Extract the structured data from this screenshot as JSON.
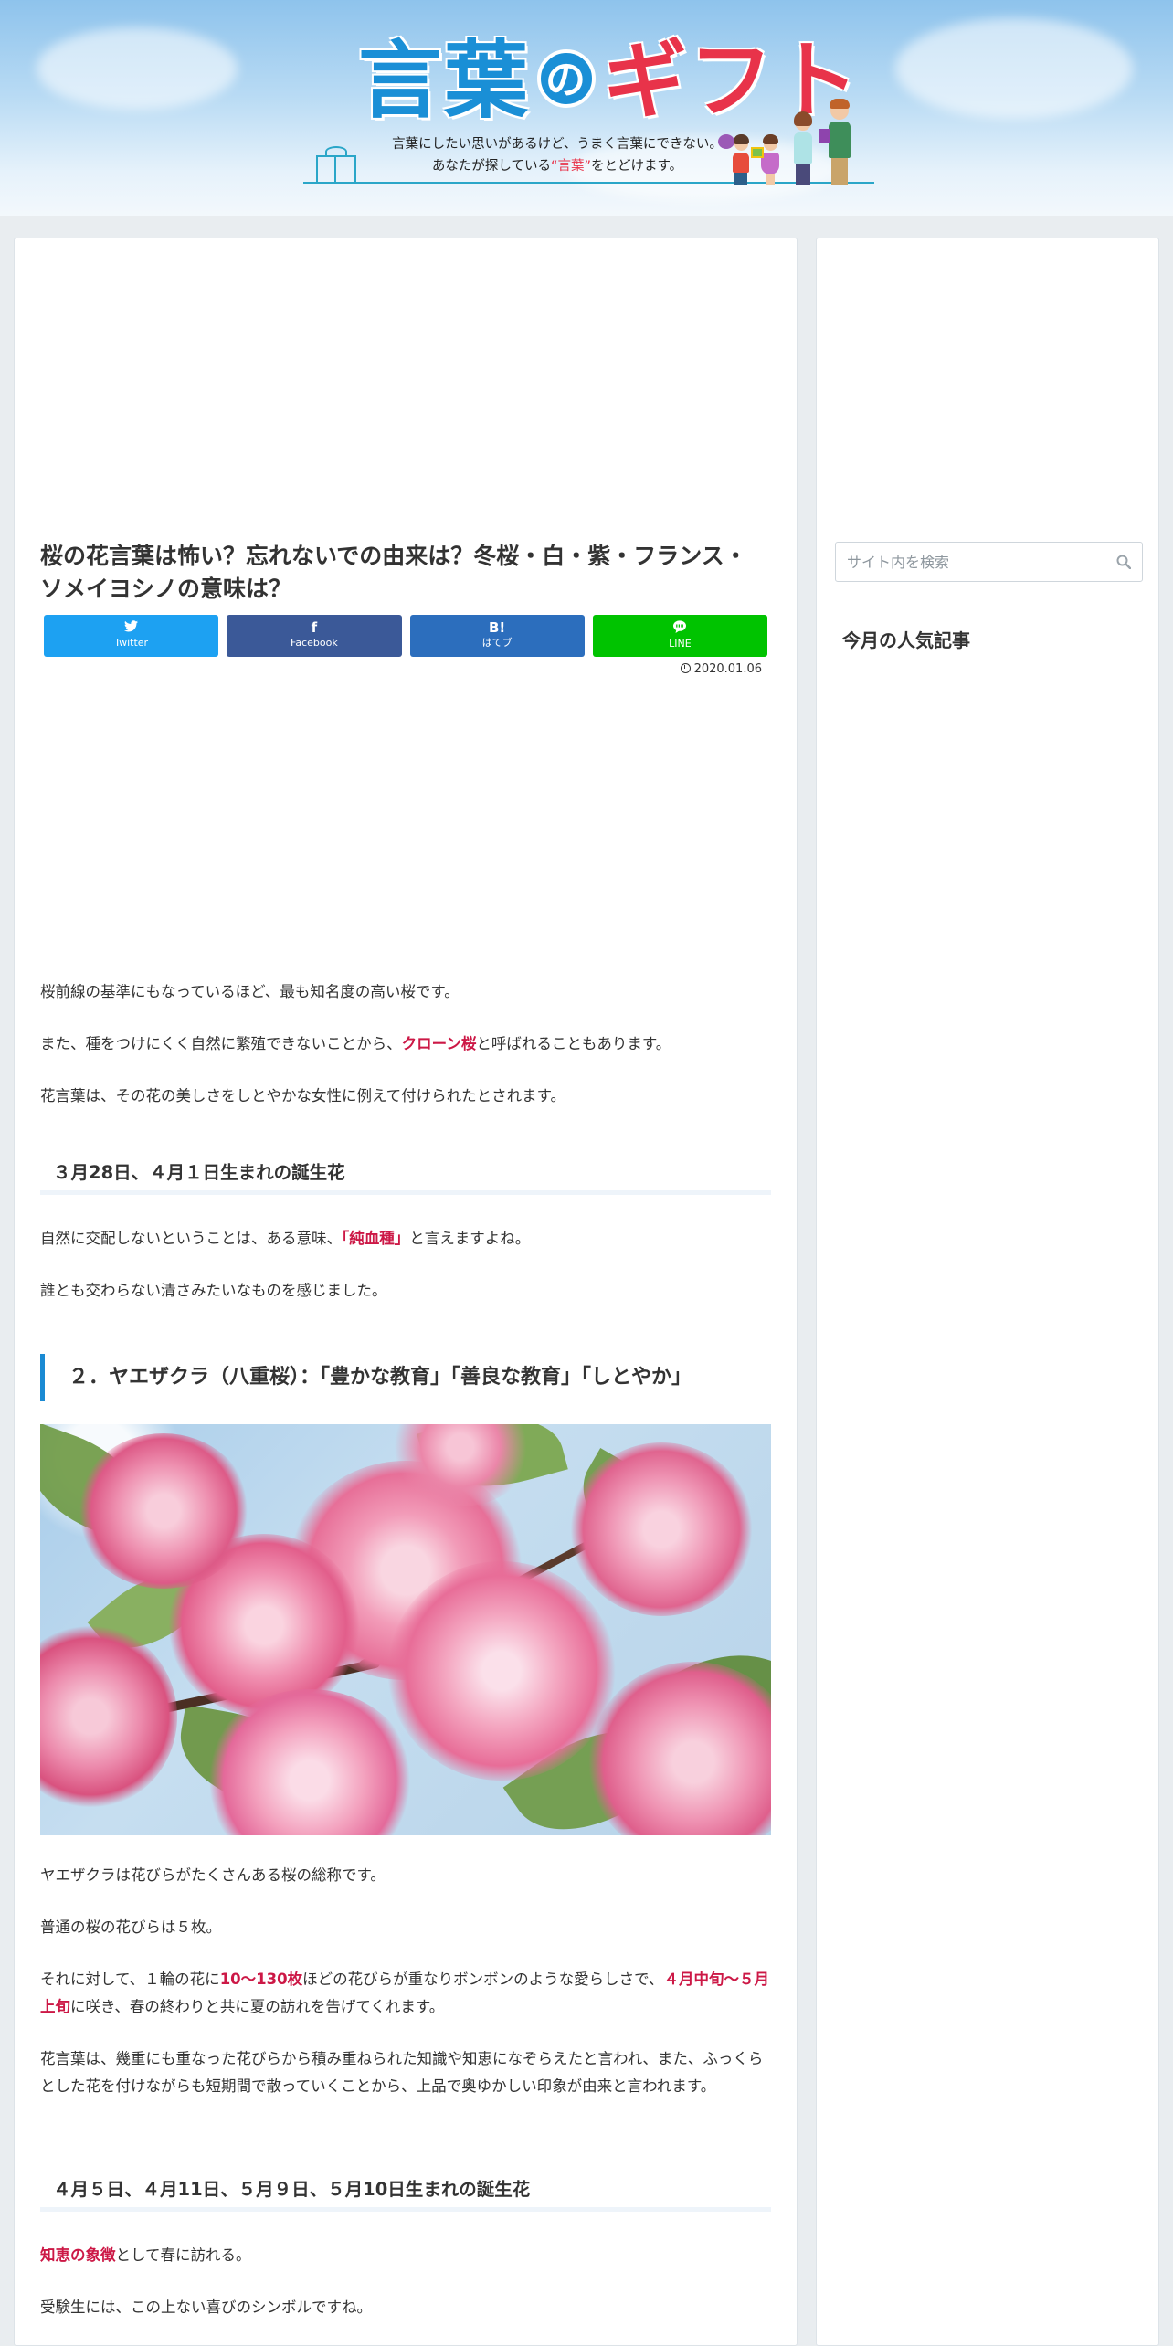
{
  "header": {
    "logo_part1": "言葉",
    "logo_no": "の",
    "logo_part2": "ギフト",
    "tagline_line1": "言葉にしたい思いがあるけど、うまく言葉にできない。",
    "tagline_line2_pre": "あなたが探している",
    "tagline_line2_hl": "“言葉”",
    "tagline_line2_post": "をとどけます。"
  },
  "article": {
    "title": "桜の花言葉は怖い？忘れないでの由来は？冬桜・白・紫・フランス・ソメイヨシノの意味は？",
    "share": {
      "twitter": "Twitter",
      "facebook": "Facebook",
      "hatena": "はてブ",
      "hatena_icon": "B!",
      "line": "LINE"
    },
    "date": "2020.01.06",
    "p1": "桜前線の基準にもなっているほど、最も知名度の高い桜です。",
    "p2_pre": "また、種をつけにくく自然に繁殖できないことから、",
    "p2_em": "クローン桜",
    "p2_post": "と呼ばれることもあります。",
    "p3": "花言葉は、その花の美しさをしとやかな女性に例えて付けられたとされます。",
    "h3_1": "３月28日、４月１日生まれの誕生花",
    "p4_pre": "自然に交配しないということは、ある意味、",
    "p4_em": "「純血種」",
    "p4_post": "と言えますよね。",
    "p5": "誰とも交わらない清さみたいなものを感じました。",
    "h2_1": "２．ヤエザクラ（八重桜）：「豊かな教育」「善良な教育」「しとやか」",
    "p6": "ヤエザクラは花びらがたくさんある桜の総称です。",
    "p7": "普通の桜の花びらは５枚。",
    "p8_pre": "それに対して、１輪の花に",
    "p8_em1": "10～130枚",
    "p8_mid": "ほどの花びらが重なりボンボンのような愛らしさで、",
    "p8_em2": "４月中旬～５月上旬",
    "p8_post": "に咲き、春の終わりと共に夏の訪れを告げてくれます。",
    "p9": "花言葉は、幾重にも重なった花びらから積み重ねられた知識や知恵になぞらえたと言われ、また、ふっくらとした花を付けながらも短期間で散っていくことから、上品で奥ゆかしい印象が由来と言われます。",
    "h3_2": "４月５日、４月11日、５月９日、５月10日生まれの誕生花",
    "p10_em": "知恵の象徴",
    "p10_post": "として春に訪れる。",
    "p11": "受験生には、この上ない喜びのシンボルですね。"
  },
  "sidebar": {
    "search_placeholder": "サイト内を検索",
    "popular_heading": "今月の人気記事"
  },
  "colors": {
    "accent_blue": "#1a8ad3",
    "emphasis_red": "#cc1846",
    "twitter": "#1da1f2",
    "facebook": "#3b5998",
    "hatena": "#2c6ebd",
    "line": "#00c300"
  }
}
